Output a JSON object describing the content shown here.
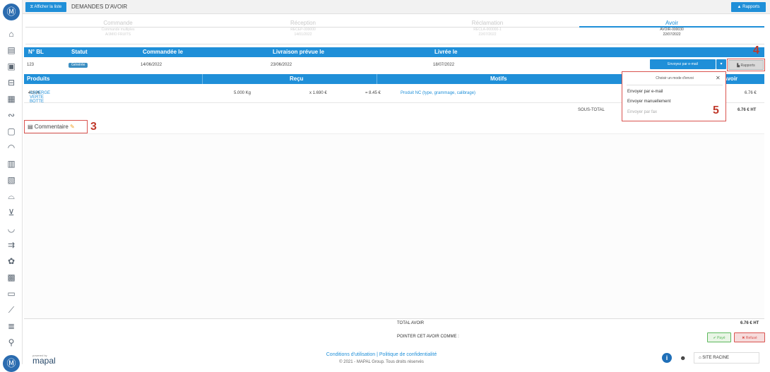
{
  "sidebar": {
    "logo": "Ⓜ",
    "items": [
      "home-icon",
      "clipboard-icon",
      "box-icon",
      "truck-icon",
      "invoice-icon",
      "handshake-icon",
      "gift-icon",
      "chef-hat-icon",
      "recipe-icon",
      "document-icon",
      "cloche-icon",
      "cart-icon",
      "dish-icon",
      "delivery-icon",
      "settings-icon",
      "calendar-icon",
      "chat-icon",
      "tools-icon",
      "database-icon",
      "wrench-icon"
    ]
  },
  "topbar": {
    "list_button": "Afficher la liste",
    "page_title": "DEMANDES D'AVOIR",
    "reports_button": "Rapports"
  },
  "steps": [
    {
      "label": "Commande",
      "sub1": "Commande multiples",
      "sub2": "A/JMIO FRUITS",
      "active": false
    },
    {
      "label": "Réception",
      "sub1": "RECEP-000000",
      "sub2": "14/01/2022",
      "active": false
    },
    {
      "label": "Réclamation",
      "sub1": "RECLA-000000-1",
      "sub2": "22/07/2022",
      "active": false
    },
    {
      "label": "Avoir",
      "sub1": "AVOIR-000030",
      "sub2": "22/07/2022",
      "active": true
    }
  ],
  "bl_table": {
    "headers": [
      "N° BL",
      "Statut",
      "Commandée le",
      "Livraison prévue le",
      "Livrée le"
    ],
    "row": {
      "bl_number": "123",
      "status": "Générée",
      "ordered": "14/06/2022",
      "expected": "23/06/2022",
      "delivered": "18/07/2022"
    }
  },
  "actions": {
    "email_button": "Envoyez par e-mail",
    "caret": "▾",
    "reports_button": "Rapports"
  },
  "products_table": {
    "headers": [
      "Produits",
      "Reçu",
      "Motifs",
      "Avoir"
    ],
    "row": {
      "code": "41636",
      "name": "ASPERGE VERTE BOTTE",
      "qty": "5.000 Kg",
      "unit_price": "x 1.690 €",
      "total": "= 8.45 €",
      "reason": "Produit NC (type, grammage, calibrage)",
      "credit": "6.76 €"
    },
    "subtotal_label": "SOUS-TOTAL",
    "subtotal_value": "6.76 € HT"
  },
  "dropdown": {
    "title": "Choisir un mode d'envoi",
    "close": "✕",
    "options": [
      "Envoyer par e-mail",
      "Envoyer manuellement",
      "Envoyer par fax"
    ]
  },
  "annotations": {
    "n3": "3",
    "n4": "4",
    "n5": "5"
  },
  "comment": {
    "label": "Commentaire"
  },
  "footer": {
    "total_label": "TOTAL AVOIR",
    "total_value": "6.76 € HT",
    "pointer_label": "POINTER CET AVOIR COMME :",
    "paid_button": "Payé",
    "refused_button": "Refusé",
    "powered_by": "powered by",
    "brand": "mapal",
    "links": "Conditions d'utilisation  |  Politique de confidentialité",
    "copyright": "© 2021 - MAPAL Group. Tous droits réservés",
    "site": "SITE RACINE"
  },
  "colors": {
    "primary": "#1f8fd8",
    "danger": "#d9534f",
    "success": "#5cb85c"
  }
}
